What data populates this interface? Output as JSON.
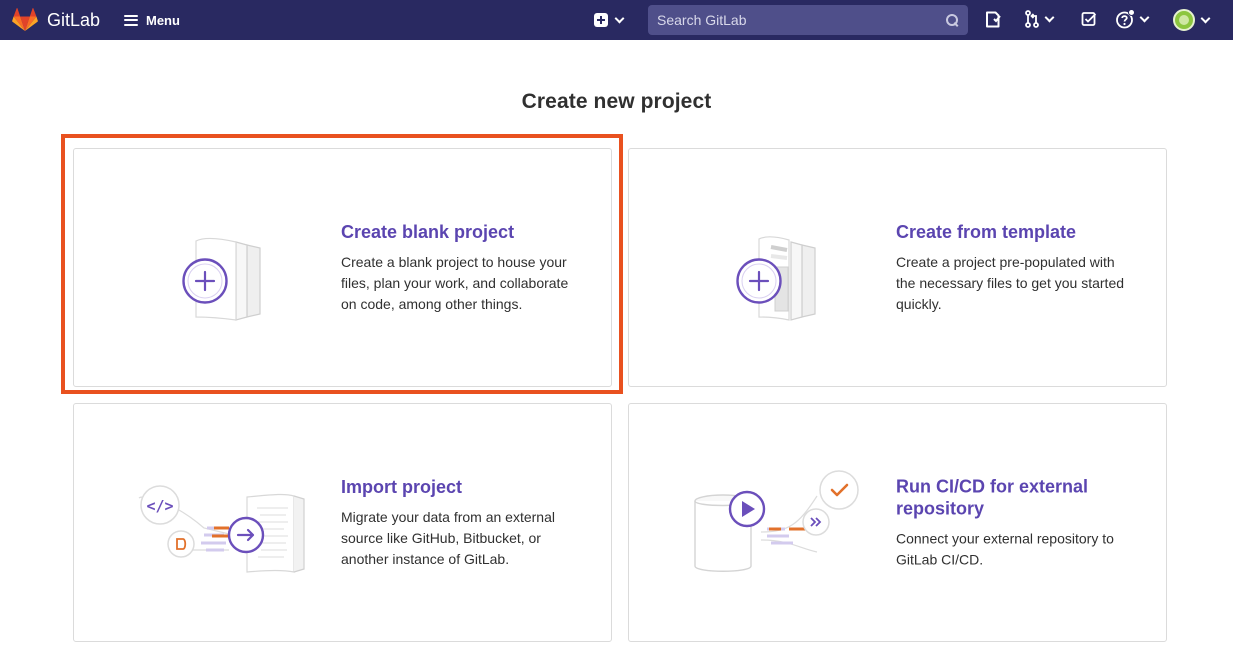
{
  "navbar": {
    "brand": "GitLab",
    "menu_label": "Menu",
    "search_placeholder": "Search GitLab"
  },
  "page": {
    "title": "Create new project"
  },
  "cards": [
    {
      "title": "Create blank project",
      "description": "Create a blank project to house your files, plan your work, and collaborate on code, among other things.",
      "illustration": "blank-project-illustration",
      "highlighted": true
    },
    {
      "title": "Create from template",
      "description": "Create a project pre-populated with the necessary files to get you started quickly.",
      "illustration": "template-project-illustration",
      "highlighted": false
    },
    {
      "title": "Import project",
      "description": "Migrate your data from an external source like GitHub, Bitbucket, or another instance of GitLab.",
      "illustration": "import-project-illustration",
      "highlighted": false
    },
    {
      "title": "Run CI/CD for external repository",
      "description": "Connect your external repository to GitLab CI/CD.",
      "illustration": "cicd-project-illustration",
      "highlighted": false
    }
  ],
  "colors": {
    "navbar": "#292961",
    "accent_purple": "#6b4fbb",
    "title_purple": "#5b45b0",
    "highlight_border": "#e9511f",
    "orange": "#e2712b"
  }
}
